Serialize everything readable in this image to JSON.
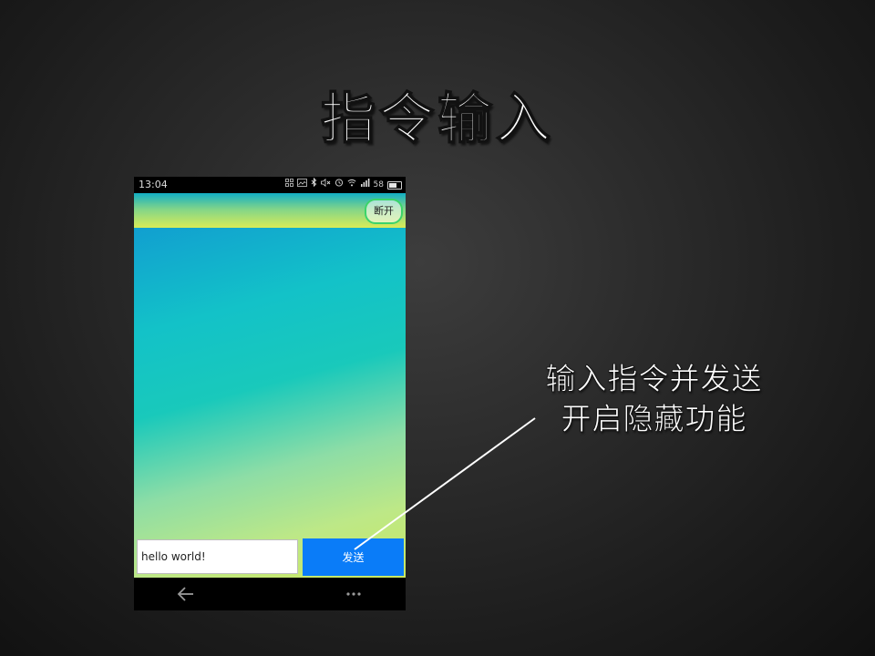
{
  "slide": {
    "title": "指令输入",
    "callout_line1": "输入指令并发送",
    "callout_line2": "开启隐藏功能"
  },
  "phone": {
    "status_bar": {
      "time": "13:04",
      "battery_level": "58",
      "icons": [
        "apps-icon",
        "image-icon",
        "bluetooth-icon",
        "mute-icon",
        "alarm-icon",
        "wifi-icon",
        "signal-icon",
        "battery-icon"
      ]
    },
    "app_bar": {
      "disconnect_label": "断开"
    },
    "input": {
      "value": "hello world!"
    },
    "send_label": "发送"
  },
  "colors": {
    "send_button": "#0a7cf8",
    "disconnect_border": "#3bd46a",
    "gradient_top": "#119fd0",
    "gradient_bottom": "#cbe85e"
  }
}
